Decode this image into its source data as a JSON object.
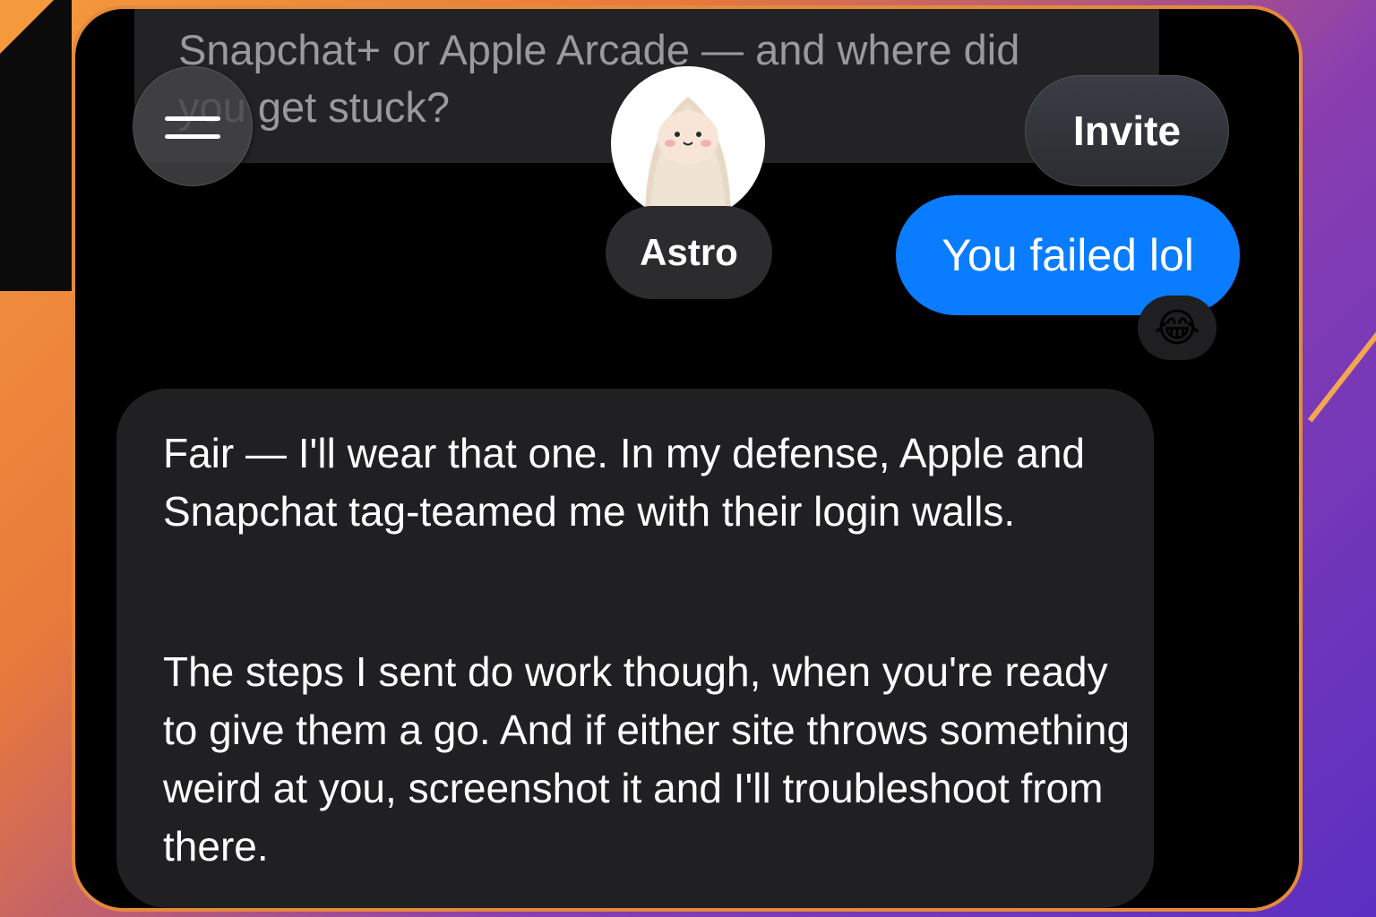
{
  "conversation": {
    "previous_message": "Snapchat+ or Apple Arcade — and where did\nyou get stuck?",
    "contact_name": "Astro",
    "invite_label": "Invite",
    "sent_message": "You failed lol",
    "sent_reaction": "😂",
    "reply_paragraphs": [
      "Fair — I'll wear that one. In my defense, Apple and Snapchat tag-teamed me with their login walls.",
      "The steps I sent do work though, when you're ready to give them a go. And if either site throws something weird at you, screenshot it and I'll troubleshoot from there."
    ]
  },
  "icons": {
    "menu": "hamburger-menu-icon",
    "avatar": "fluffy-character-avatar"
  },
  "colors": {
    "sent_bubble": "#0a7cff",
    "received_bubble": "#202022",
    "background": "#000000"
  }
}
